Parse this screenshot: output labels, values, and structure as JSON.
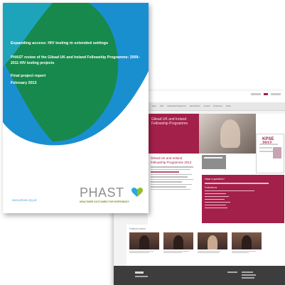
{
  "report": {
    "title": "Expanding access: HIV testing in extended settings",
    "subtitle": "PHAST review of the Gilead UK and Ireland Fellowship Programme: 2009–2011 HIV testing projects",
    "report_type": "Final project report",
    "date": "February 2013",
    "url": "www.phast.org.uk",
    "brand": {
      "name": "PHAST",
      "tagline": "HEALTHIER OUTCOMES FOR EVERYBODY"
    },
    "colors": {
      "blue": "#1a8fd0",
      "green": "#17894c",
      "green_dark": "#0f6f3b",
      "teal": "#1fa7c6"
    }
  },
  "website": {
    "nav_items": [
      "Home",
      "Pfizer Clinical Fellowship",
      "News",
      "FAQ",
      "Fellowship Programme",
      "Past Fellows",
      "Contact",
      "Resources",
      "About"
    ],
    "hero_title": "Gilead UK and Ireland Fellowship Programme",
    "intro_heading": "Gilead UK and Ireland Fellowship Programme 2013",
    "event_label": "KPSE 2012",
    "question_text": "Have a question?",
    "sub_text": "Publications",
    "videos_heading": "Featured videos",
    "accent": "#a3204a",
    "footer_color": "#3d3d3d"
  }
}
